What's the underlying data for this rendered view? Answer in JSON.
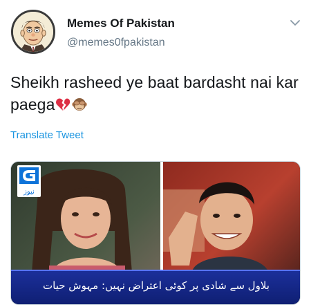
{
  "author": {
    "display_name": "Memes Of Pakistan",
    "handle": "@memes0fpakistan"
  },
  "tweet": {
    "text": "Sheikh rasheed ye baat bardasht nai kar paega",
    "emojis": [
      "broken-heart-emoji",
      "see-no-evil-monkey-emoji"
    ],
    "translate_label": "Translate Tweet"
  },
  "media": {
    "channel_logo_text": "نیوز",
    "caption": "بلاول سے شادی پر کوئی اعتراض نہیں: مہوش حیات"
  },
  "colors": {
    "link": "#1b95e0",
    "secondary_text": "#657786",
    "caption_bar": "#1b2f9a"
  }
}
